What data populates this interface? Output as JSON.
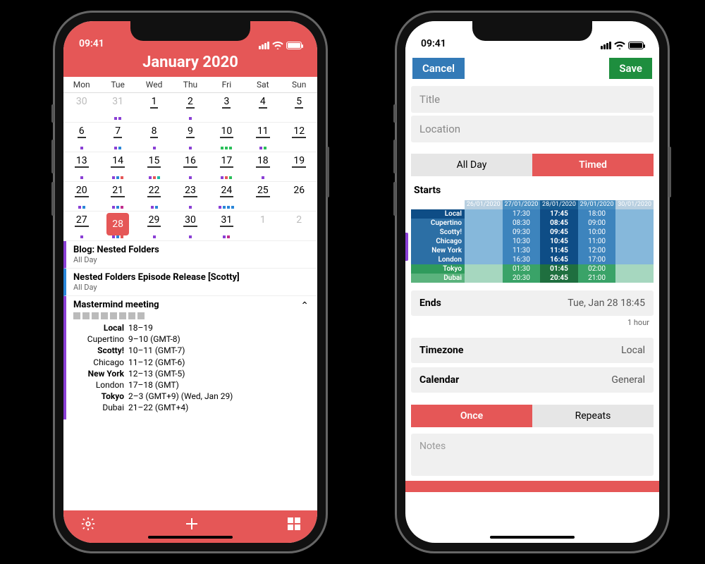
{
  "status": {
    "time": "09:41"
  },
  "calendar": {
    "title": "January 2020",
    "weekdays": [
      "Mon",
      "Tue",
      "Wed",
      "Thu",
      "Fri",
      "Sat",
      "Sun"
    ],
    "grid": [
      [
        {
          "n": "30",
          "muted": true
        },
        {
          "n": "31",
          "muted": true,
          "dots": [
            "p",
            "p"
          ]
        },
        {
          "n": "1",
          "ul": true
        },
        {
          "n": "2",
          "ul": true,
          "dots": [
            "p"
          ]
        },
        {
          "n": "3",
          "ul": true
        },
        {
          "n": "4",
          "ul": true
        },
        {
          "n": "5",
          "ul": true
        }
      ],
      [
        {
          "n": "6",
          "ul": true,
          "dots": [
            "p"
          ]
        },
        {
          "n": "7",
          "ul": true,
          "dots": [
            "p",
            "b"
          ]
        },
        {
          "n": "8",
          "ul": true,
          "dots": [
            "p"
          ]
        },
        {
          "n": "9",
          "ul": true,
          "dots": [
            "p"
          ]
        },
        {
          "n": "10",
          "ul": true,
          "dots": [
            "g",
            "g",
            "g"
          ]
        },
        {
          "n": "11",
          "ul": true,
          "dots": [
            "p",
            "g"
          ]
        },
        {
          "n": "12",
          "ul": true
        }
      ],
      [
        {
          "n": "13",
          "ul": true,
          "dots": [
            "p"
          ]
        },
        {
          "n": "14",
          "ul": true,
          "dots": [
            "p",
            "b",
            "r"
          ]
        },
        {
          "n": "15",
          "ul": true,
          "dots": [
            "p",
            "r",
            "t"
          ]
        },
        {
          "n": "16",
          "ul": true,
          "dots": [
            "p"
          ]
        },
        {
          "n": "17",
          "ul": true,
          "dots": [
            "p",
            "r",
            "g"
          ]
        },
        {
          "n": "18",
          "ul": true,
          "dots": [
            "p"
          ]
        },
        {
          "n": "19",
          "ul": true
        }
      ],
      [
        {
          "n": "20",
          "ul": true,
          "dots": [
            "p",
            "b"
          ]
        },
        {
          "n": "21",
          "ul": true,
          "dots": [
            "p",
            "b",
            "m"
          ]
        },
        {
          "n": "22",
          "ul": true,
          "dots": [
            "p",
            "b"
          ]
        },
        {
          "n": "23",
          "ul": true,
          "dots": [
            "p"
          ]
        },
        {
          "n": "24",
          "ul": true,
          "dots": [
            "p",
            "b",
            "b",
            "b"
          ]
        },
        {
          "n": "25",
          "ul": true
        },
        {
          "n": "26"
        }
      ],
      [
        {
          "n": "27",
          "ul": true,
          "dots": [
            "p"
          ]
        },
        {
          "n": "28",
          "sel": true,
          "dots": [
            "p",
            "b",
            "r"
          ]
        },
        {
          "n": "29",
          "ul": true,
          "dots": [
            "p"
          ]
        },
        {
          "n": "30",
          "ul": true,
          "dots": [
            "p"
          ]
        },
        {
          "n": "31",
          "ul": true,
          "dots": [
            "p",
            "m"
          ]
        },
        {
          "n": "1",
          "muted": true
        },
        {
          "n": "2",
          "muted": true
        }
      ]
    ]
  },
  "events": [
    {
      "color": "p",
      "title": "Blog: Nested Folders",
      "sub": "All Day"
    },
    {
      "color": "b",
      "title": "Nested Folders Episode Release [Scotty]",
      "sub": "All Day"
    }
  ],
  "mastermind": {
    "title": "Mastermind meeting",
    "rows": [
      {
        "bold": true,
        "lab": "Local",
        "val": "18–19"
      },
      {
        "bold": false,
        "lab": "Cupertino",
        "val": "9–10 (GMT-8)"
      },
      {
        "bold": true,
        "lab": "Scotty!",
        "val": "10–11 (GMT-7)"
      },
      {
        "bold": false,
        "lab": "Chicago",
        "val": "11–12 (GMT-6)"
      },
      {
        "bold": true,
        "lab": "New York",
        "val": "12–13 (GMT-5)"
      },
      {
        "bold": false,
        "lab": "London",
        "val": "17–18 (GMT)"
      },
      {
        "bold": true,
        "lab": "Tokyo",
        "val": "2–3 (GMT+9) (Wed, Jan 29)"
      },
      {
        "bold": false,
        "lab": "Dubai",
        "val": "21–22 (GMT+4)"
      }
    ]
  },
  "form": {
    "cancel": "Cancel",
    "save": "Save",
    "title_ph": "Title",
    "location_ph": "Location",
    "seg1": {
      "a": "All Day",
      "b": "Timed"
    },
    "starts": "Starts",
    "ends_label": "Ends",
    "ends_value": "Tue, Jan 28 18:45",
    "duration": "1 hour",
    "tz_label": "Timezone",
    "tz_value": "Local",
    "cal_label": "Calendar",
    "cal_value": "General",
    "seg2": {
      "a": "Once",
      "b": "Repeats"
    },
    "notes_ph": "Notes"
  },
  "picker": {
    "dates": [
      "26/01/2020",
      "27/01/2020",
      "28/01/2020",
      "29/01/2020",
      "30/01/2020"
    ],
    "rows": [
      {
        "lab": "Local",
        "cls": "loc",
        "cells": [
          "17:30",
          "17:45",
          "18:00"
        ]
      },
      {
        "lab": "Cupertino",
        "cls": "std",
        "cells": [
          "08:30",
          "08:45",
          "09:00"
        ]
      },
      {
        "lab": "Scotty!",
        "cls": "std",
        "cells": [
          "09:30",
          "09:45",
          "10:00"
        ]
      },
      {
        "lab": "Chicago",
        "cls": "std",
        "cells": [
          "10:30",
          "10:45",
          "11:00"
        ]
      },
      {
        "lab": "New York",
        "cls": "std",
        "cells": [
          "11:30",
          "11:45",
          "12:00"
        ]
      },
      {
        "lab": "London",
        "cls": "std",
        "cells": [
          "16:30",
          "16:45",
          "17:00"
        ]
      },
      {
        "lab": "Tokyo",
        "cls": "tok",
        "green": true,
        "cells": [
          "01:30",
          "01:45",
          "02:00"
        ]
      },
      {
        "lab": "Dubai",
        "cls": "dub",
        "green": true,
        "cells": [
          "20:30",
          "20:45",
          "21:00"
        ]
      }
    ]
  }
}
